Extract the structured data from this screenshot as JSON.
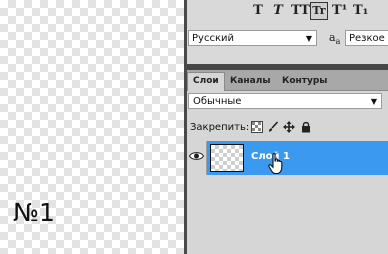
{
  "canvas": {
    "label": "№1"
  },
  "character": {
    "style_buttons": [
      "T",
      "T",
      "TT",
      "Tr",
      "T¹",
      "T₁"
    ],
    "language": "Русский",
    "aa_glyph": "a",
    "aa_sub": "a",
    "aa_value": "Резкое"
  },
  "layers": {
    "tabs": [
      "Слои",
      "Каналы",
      "Контуры"
    ],
    "blend_mode": "Обычные",
    "lock_label": "Закрепить:",
    "layer_name": "Слой 1"
  },
  "colors": {
    "selection": "#3c99f0",
    "divider": "#474747"
  }
}
